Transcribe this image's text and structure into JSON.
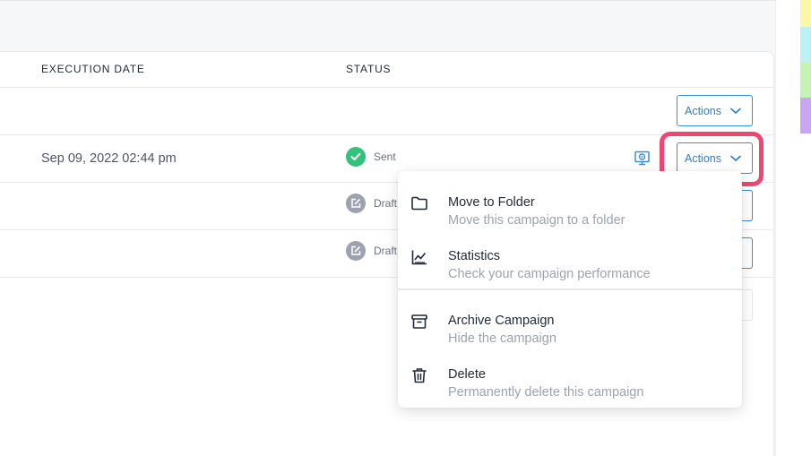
{
  "table": {
    "headers": {
      "execution_date": "EXECUTION DATE",
      "status": "STATUS"
    },
    "rows": [
      {
        "date": "",
        "status": ""
      },
      {
        "date": "Sep 09, 2022 02:44 pm",
        "status": "Sent"
      },
      {
        "date": "",
        "status": "Draft"
      },
      {
        "date": "",
        "status": "Draft"
      }
    ],
    "actions_label": "Actions"
  },
  "menu": {
    "items": [
      {
        "title": "Move to Folder",
        "subtitle": "Move this campaign to a folder",
        "icon": "folder-icon"
      },
      {
        "title": "Statistics",
        "subtitle": "Check your campaign performance",
        "icon": "chart-line-icon"
      },
      {
        "title": "Archive Campaign",
        "subtitle": "Hide the campaign",
        "icon": "archive-icon"
      },
      {
        "title": "Delete",
        "subtitle": "Permanently delete this campaign",
        "icon": "trash-icon"
      }
    ]
  },
  "colors": {
    "accent": "#3b8fd1",
    "sent": "#34c17b",
    "draft": "#9ca3af",
    "highlight": "#f0466f",
    "swatch_yellow": "#fbf7a6",
    "swatch_cyan": "#bdf0f4",
    "swatch_green": "#c6f2b5",
    "swatch_purple": "#c9a6f2"
  }
}
